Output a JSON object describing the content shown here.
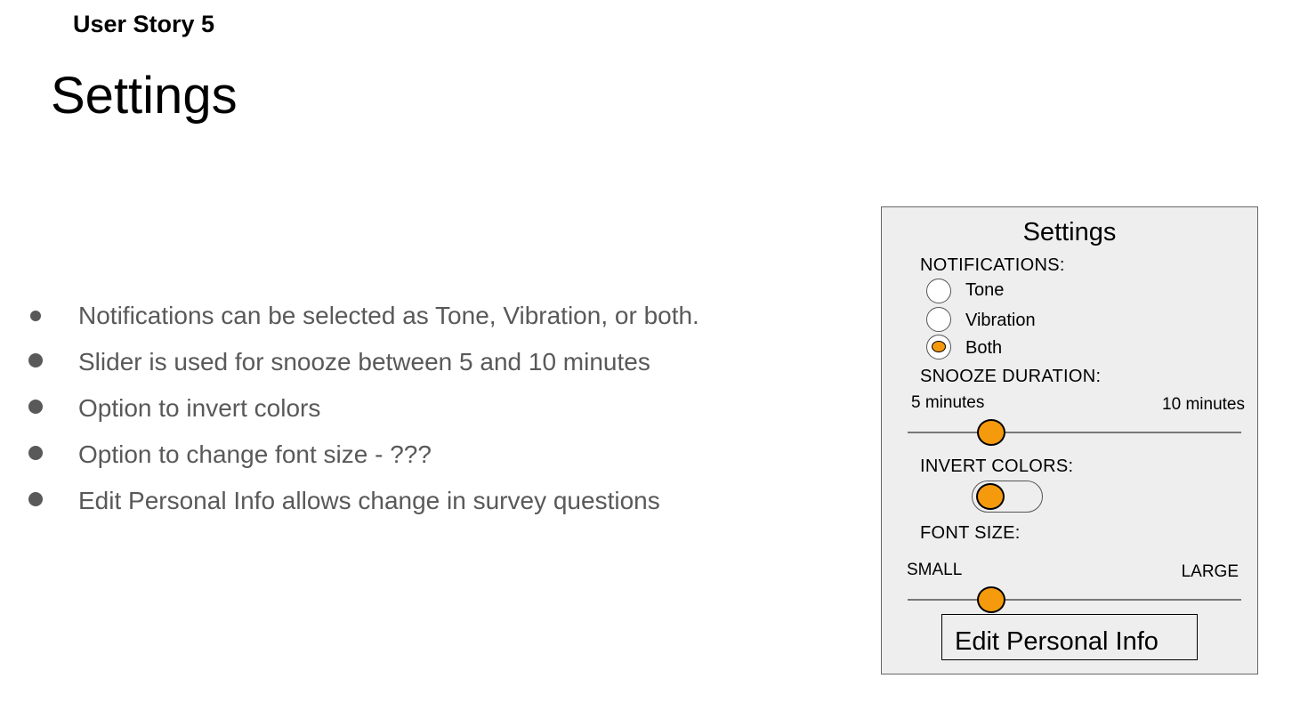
{
  "header": {
    "story_label": "User Story 5",
    "title": "Settings"
  },
  "bullets": [
    "Notifications can be selected as Tone, Vibration, or both.",
    "Slider is used for snooze between 5 and 10 minutes",
    "Option to invert colors",
    "Option to change font size - ???",
    "Edit Personal Info allows change in survey questions"
  ],
  "mockup": {
    "title": "Settings",
    "notifications": {
      "label": "NOTIFICATIONS:",
      "options": [
        "Tone",
        "Vibration",
        "Both"
      ],
      "selected": "Both"
    },
    "snooze": {
      "label": "SNOOZE DURATION:",
      "min_label": "5 minutes",
      "max_label": "10 minutes",
      "value_fraction": 0.25
    },
    "invert": {
      "label": "INVERT COLORS:"
    },
    "font_size": {
      "label": "FONT SIZE:",
      "min_label": "SMALL",
      "max_label": "LARGE",
      "value_fraction": 0.25
    },
    "edit_button": "Edit Personal Info"
  },
  "colors": {
    "accent": "#f59a0c",
    "panel_bg": "#eeeeee",
    "bullet_text": "#595959"
  }
}
